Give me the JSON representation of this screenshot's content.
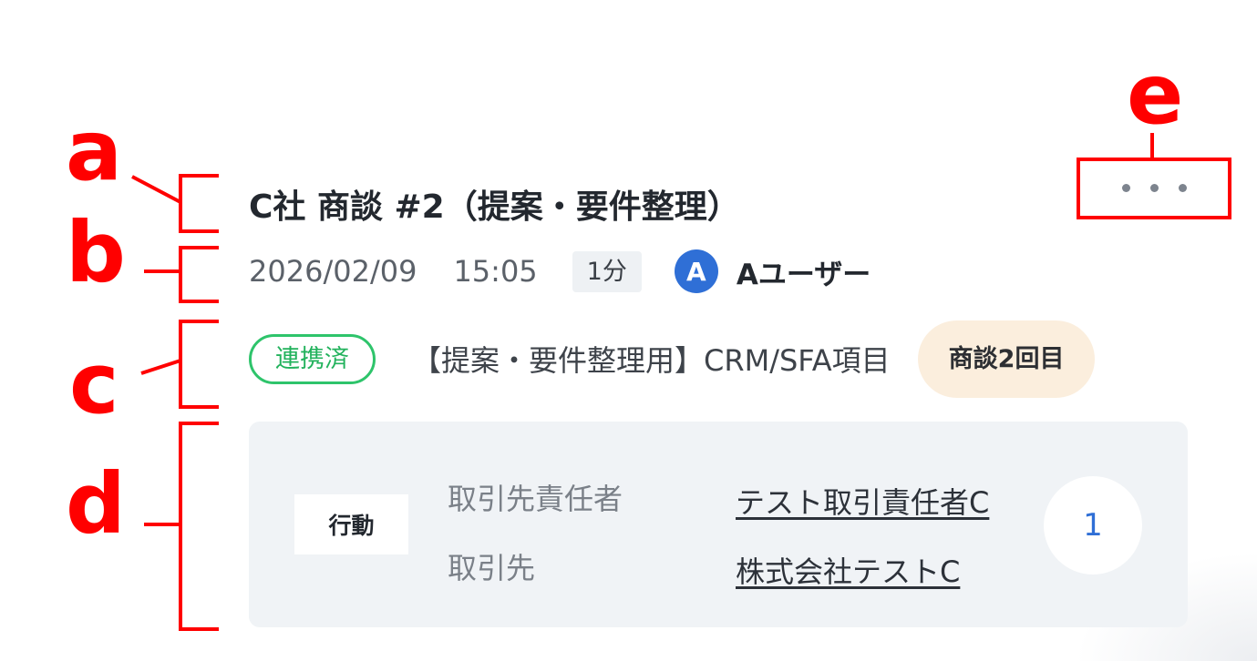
{
  "annotations": {
    "a": "a",
    "b": "b",
    "c": "c",
    "d": "d",
    "e": "e"
  },
  "meeting": {
    "title": "C社 商談 #2（提案・要件整理）",
    "date": "2026/02/09",
    "time": "15:05",
    "duration": "1分",
    "user_initial": "A",
    "user_name": "Aユーザー"
  },
  "tags": {
    "status": "連携済",
    "crm_label": "【提案・要件整理用】CRM/SFA項目",
    "round": "商談2回目"
  },
  "detail": {
    "action_label": "行動",
    "contact_label": "取引先責任者",
    "contact_value": "テスト取引責任者C",
    "account_label": "取引先",
    "account_value": "株式会社テストC",
    "count": "1"
  },
  "icons": {
    "more": "more-horizontal-icon"
  },
  "colors": {
    "annotation": "#ff0000",
    "status_green": "#2ec46b",
    "avatar_blue": "#2f6fd6",
    "round_tag_bg": "#fbeedd",
    "panel_bg": "#f0f3f6"
  }
}
